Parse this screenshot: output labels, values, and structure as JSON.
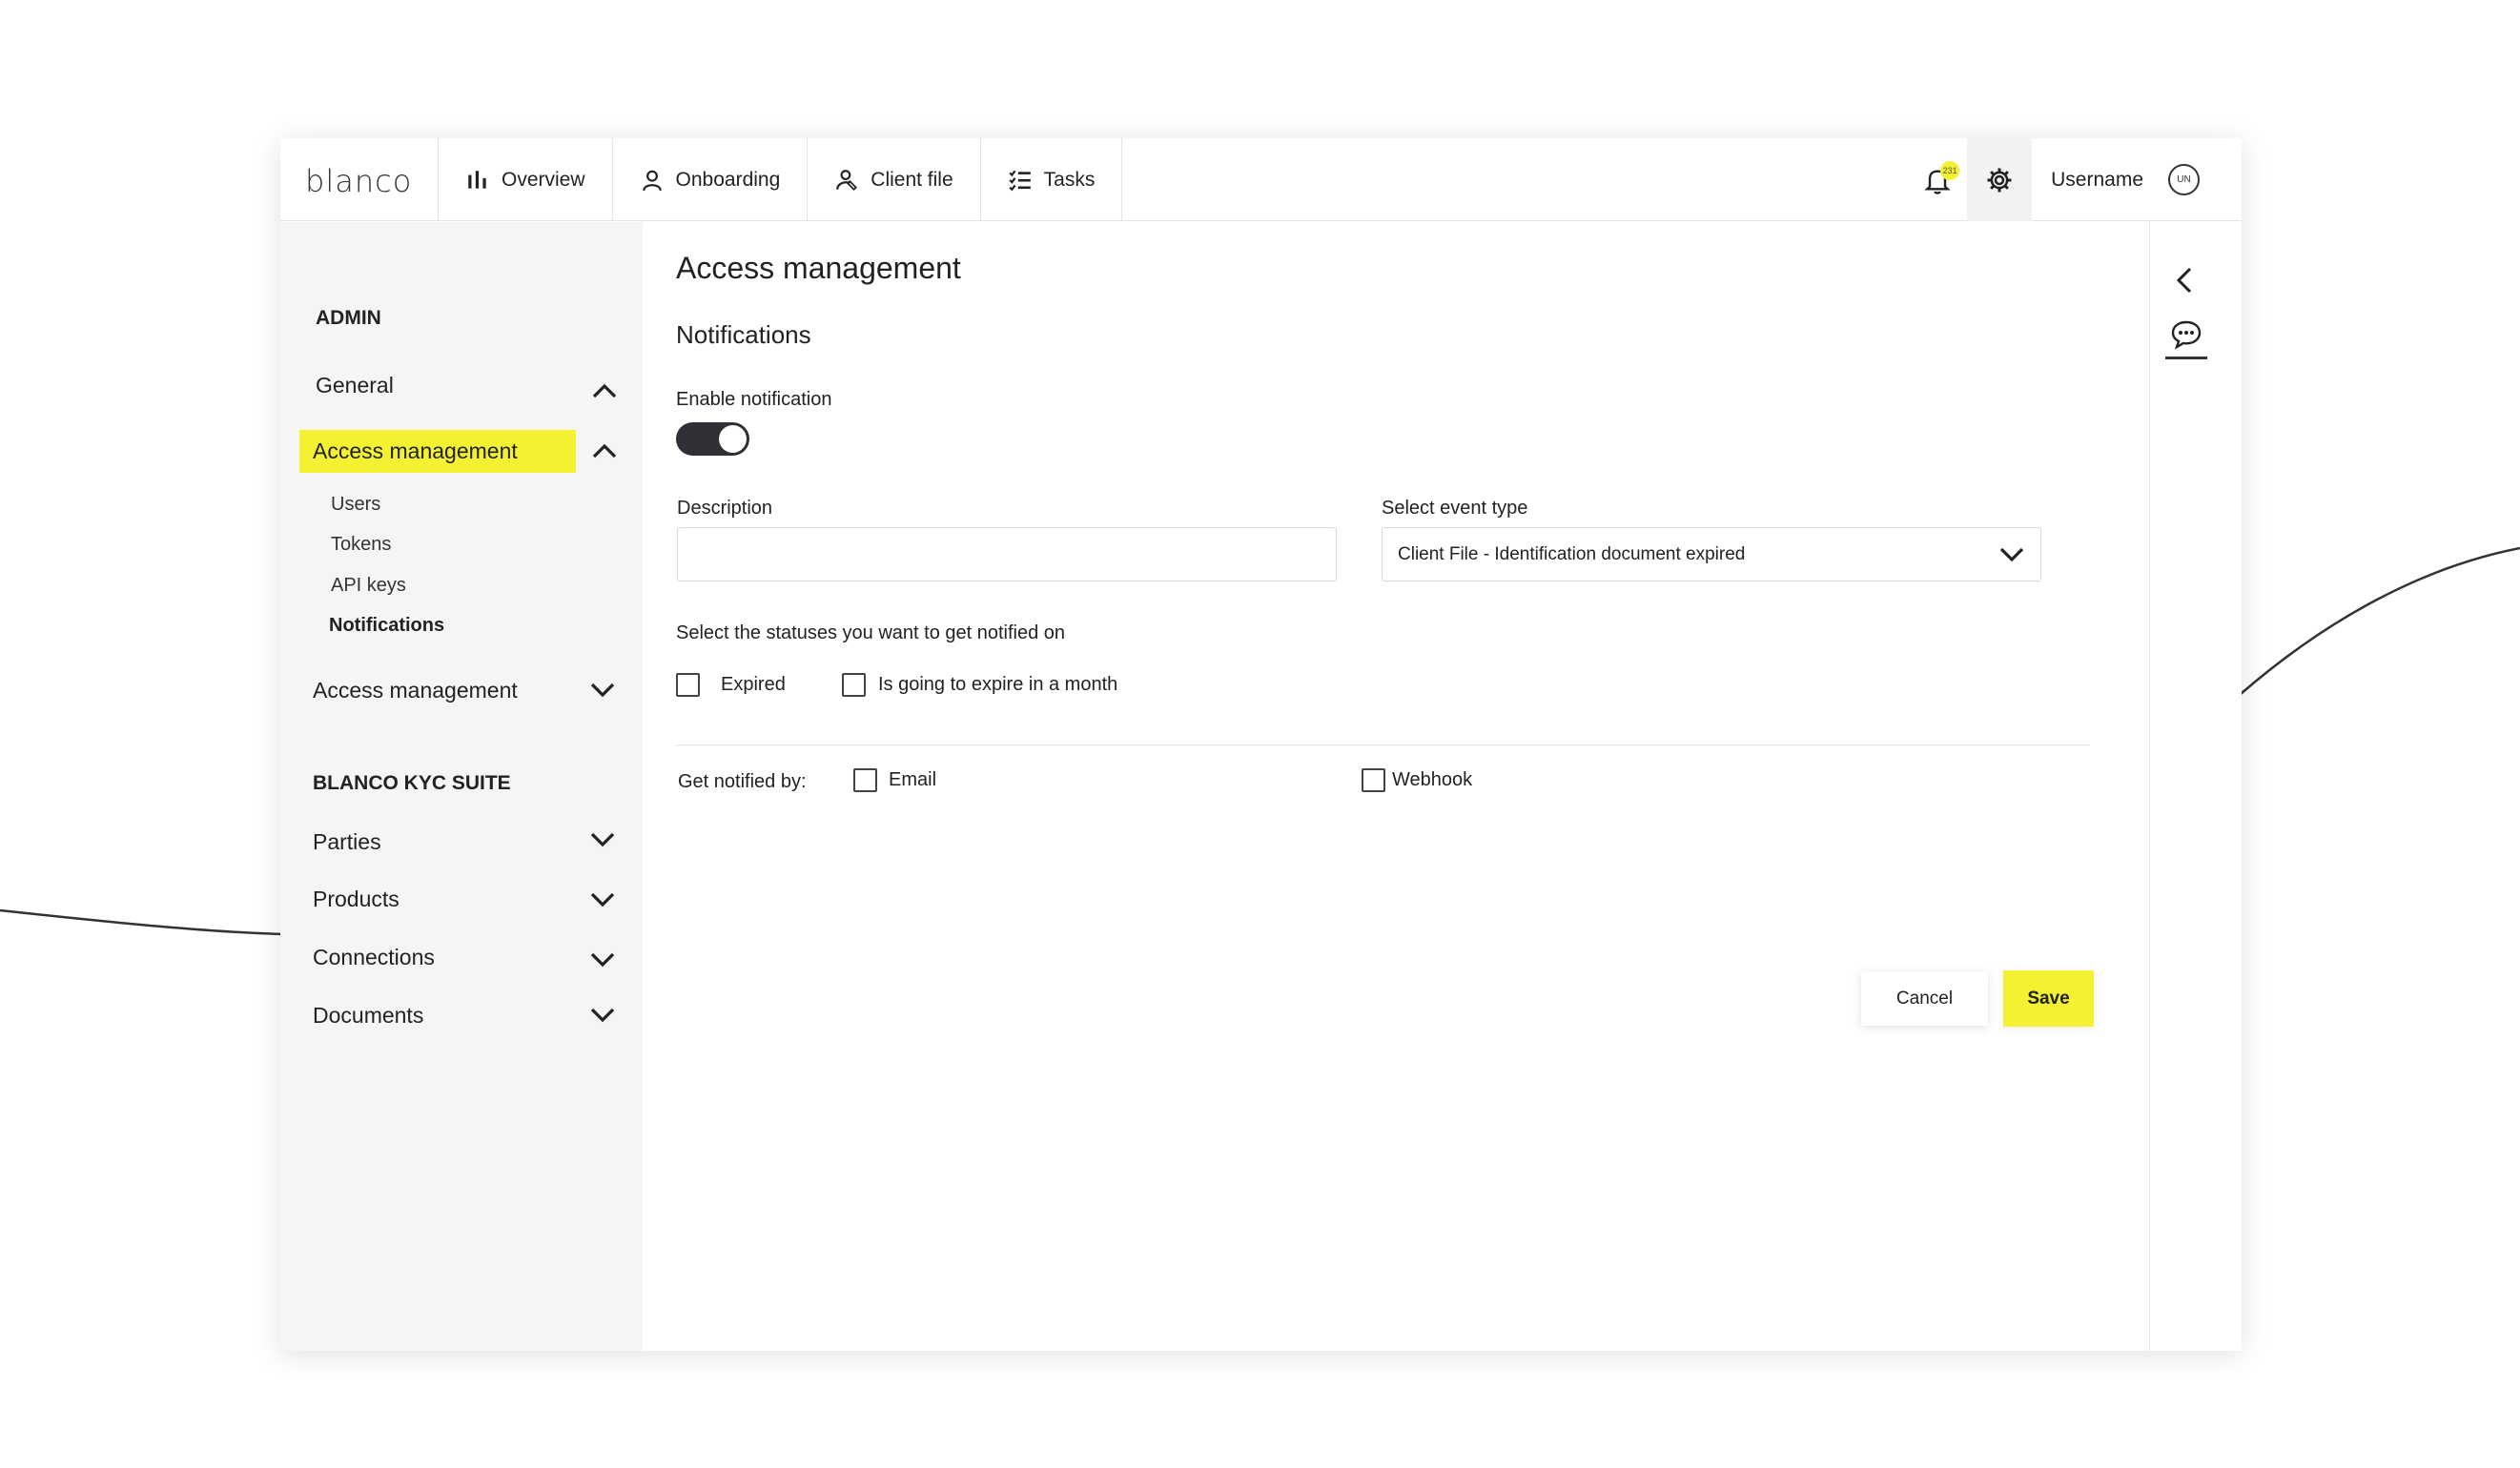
{
  "app": {
    "logo": "blanco"
  },
  "nav": [
    {
      "label": "Overview",
      "icon": "bar-chart-icon"
    },
    {
      "label": "Onboarding",
      "icon": "person-icon"
    },
    {
      "label": "Client file",
      "icon": "client-file-icon"
    },
    {
      "label": "Tasks",
      "icon": "task-list-icon"
    }
  ],
  "topbar": {
    "notification_count": "231",
    "username": "Username",
    "avatar_initials": "UN"
  },
  "sidebar": {
    "admin_heading": "ADMIN",
    "general": "General",
    "access_management_active": "Access management",
    "sub_items": [
      "Users",
      "Tokens",
      "API keys",
      "Notifications"
    ],
    "access_management_2": "Access management",
    "suite_heading": "BLANCO KYC SUITE",
    "suite_items": [
      "Parties",
      "Products",
      "Connections",
      "Documents"
    ]
  },
  "main": {
    "title": "Access management",
    "section_title": "Notifications",
    "enable_label": "Enable notification",
    "enable_on": true,
    "description_label": "Description",
    "description_value": "",
    "event_type_label": "Select event type",
    "event_type_value": "Client File - Identification document expired",
    "statuses_label": "Select the statuses you want to get notified on",
    "status_options": [
      "Expired",
      "Is going to expire in a month"
    ],
    "notified_by_label": "Get notified by:",
    "channels": [
      "Email",
      "Webhook"
    ],
    "cancel_label": "Cancel",
    "save_label": "Save"
  },
  "colors": {
    "accent": "#f3f131",
    "toggle": "#2f2f36",
    "sidebar_bg": "#f5f5f5"
  }
}
